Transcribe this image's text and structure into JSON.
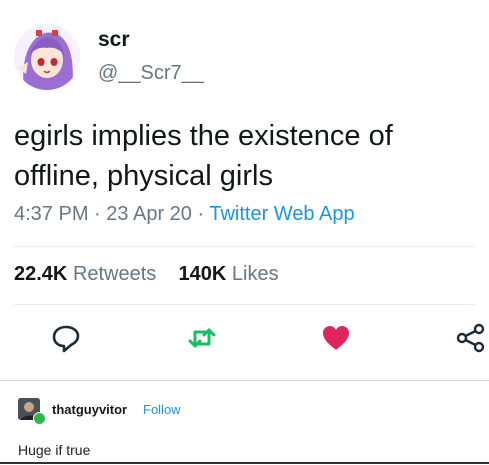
{
  "tweet": {
    "display_name": "scr",
    "handle": "@__Scr7__",
    "text": "egirls implies the existence of offline, physical girls",
    "time": "4:37 PM",
    "date": "23 Apr 20",
    "sep": "·",
    "source": "Twitter Web App",
    "retweets_count": "22.4K",
    "retweets_label": "Retweets",
    "likes_count": "140K",
    "likes_label": "Likes"
  },
  "icons": {
    "reply": "reply-icon",
    "retweet": "retweet-icon",
    "like": "heart-icon",
    "share": "share-icon"
  },
  "colors": {
    "heart": "#e0245e",
    "retweet": "#17bf63",
    "link": "#1b95e0",
    "muted": "#657786"
  },
  "reply_post": {
    "username": "thatguyvitor",
    "follow_label": "Follow",
    "text": "Huge if true"
  }
}
